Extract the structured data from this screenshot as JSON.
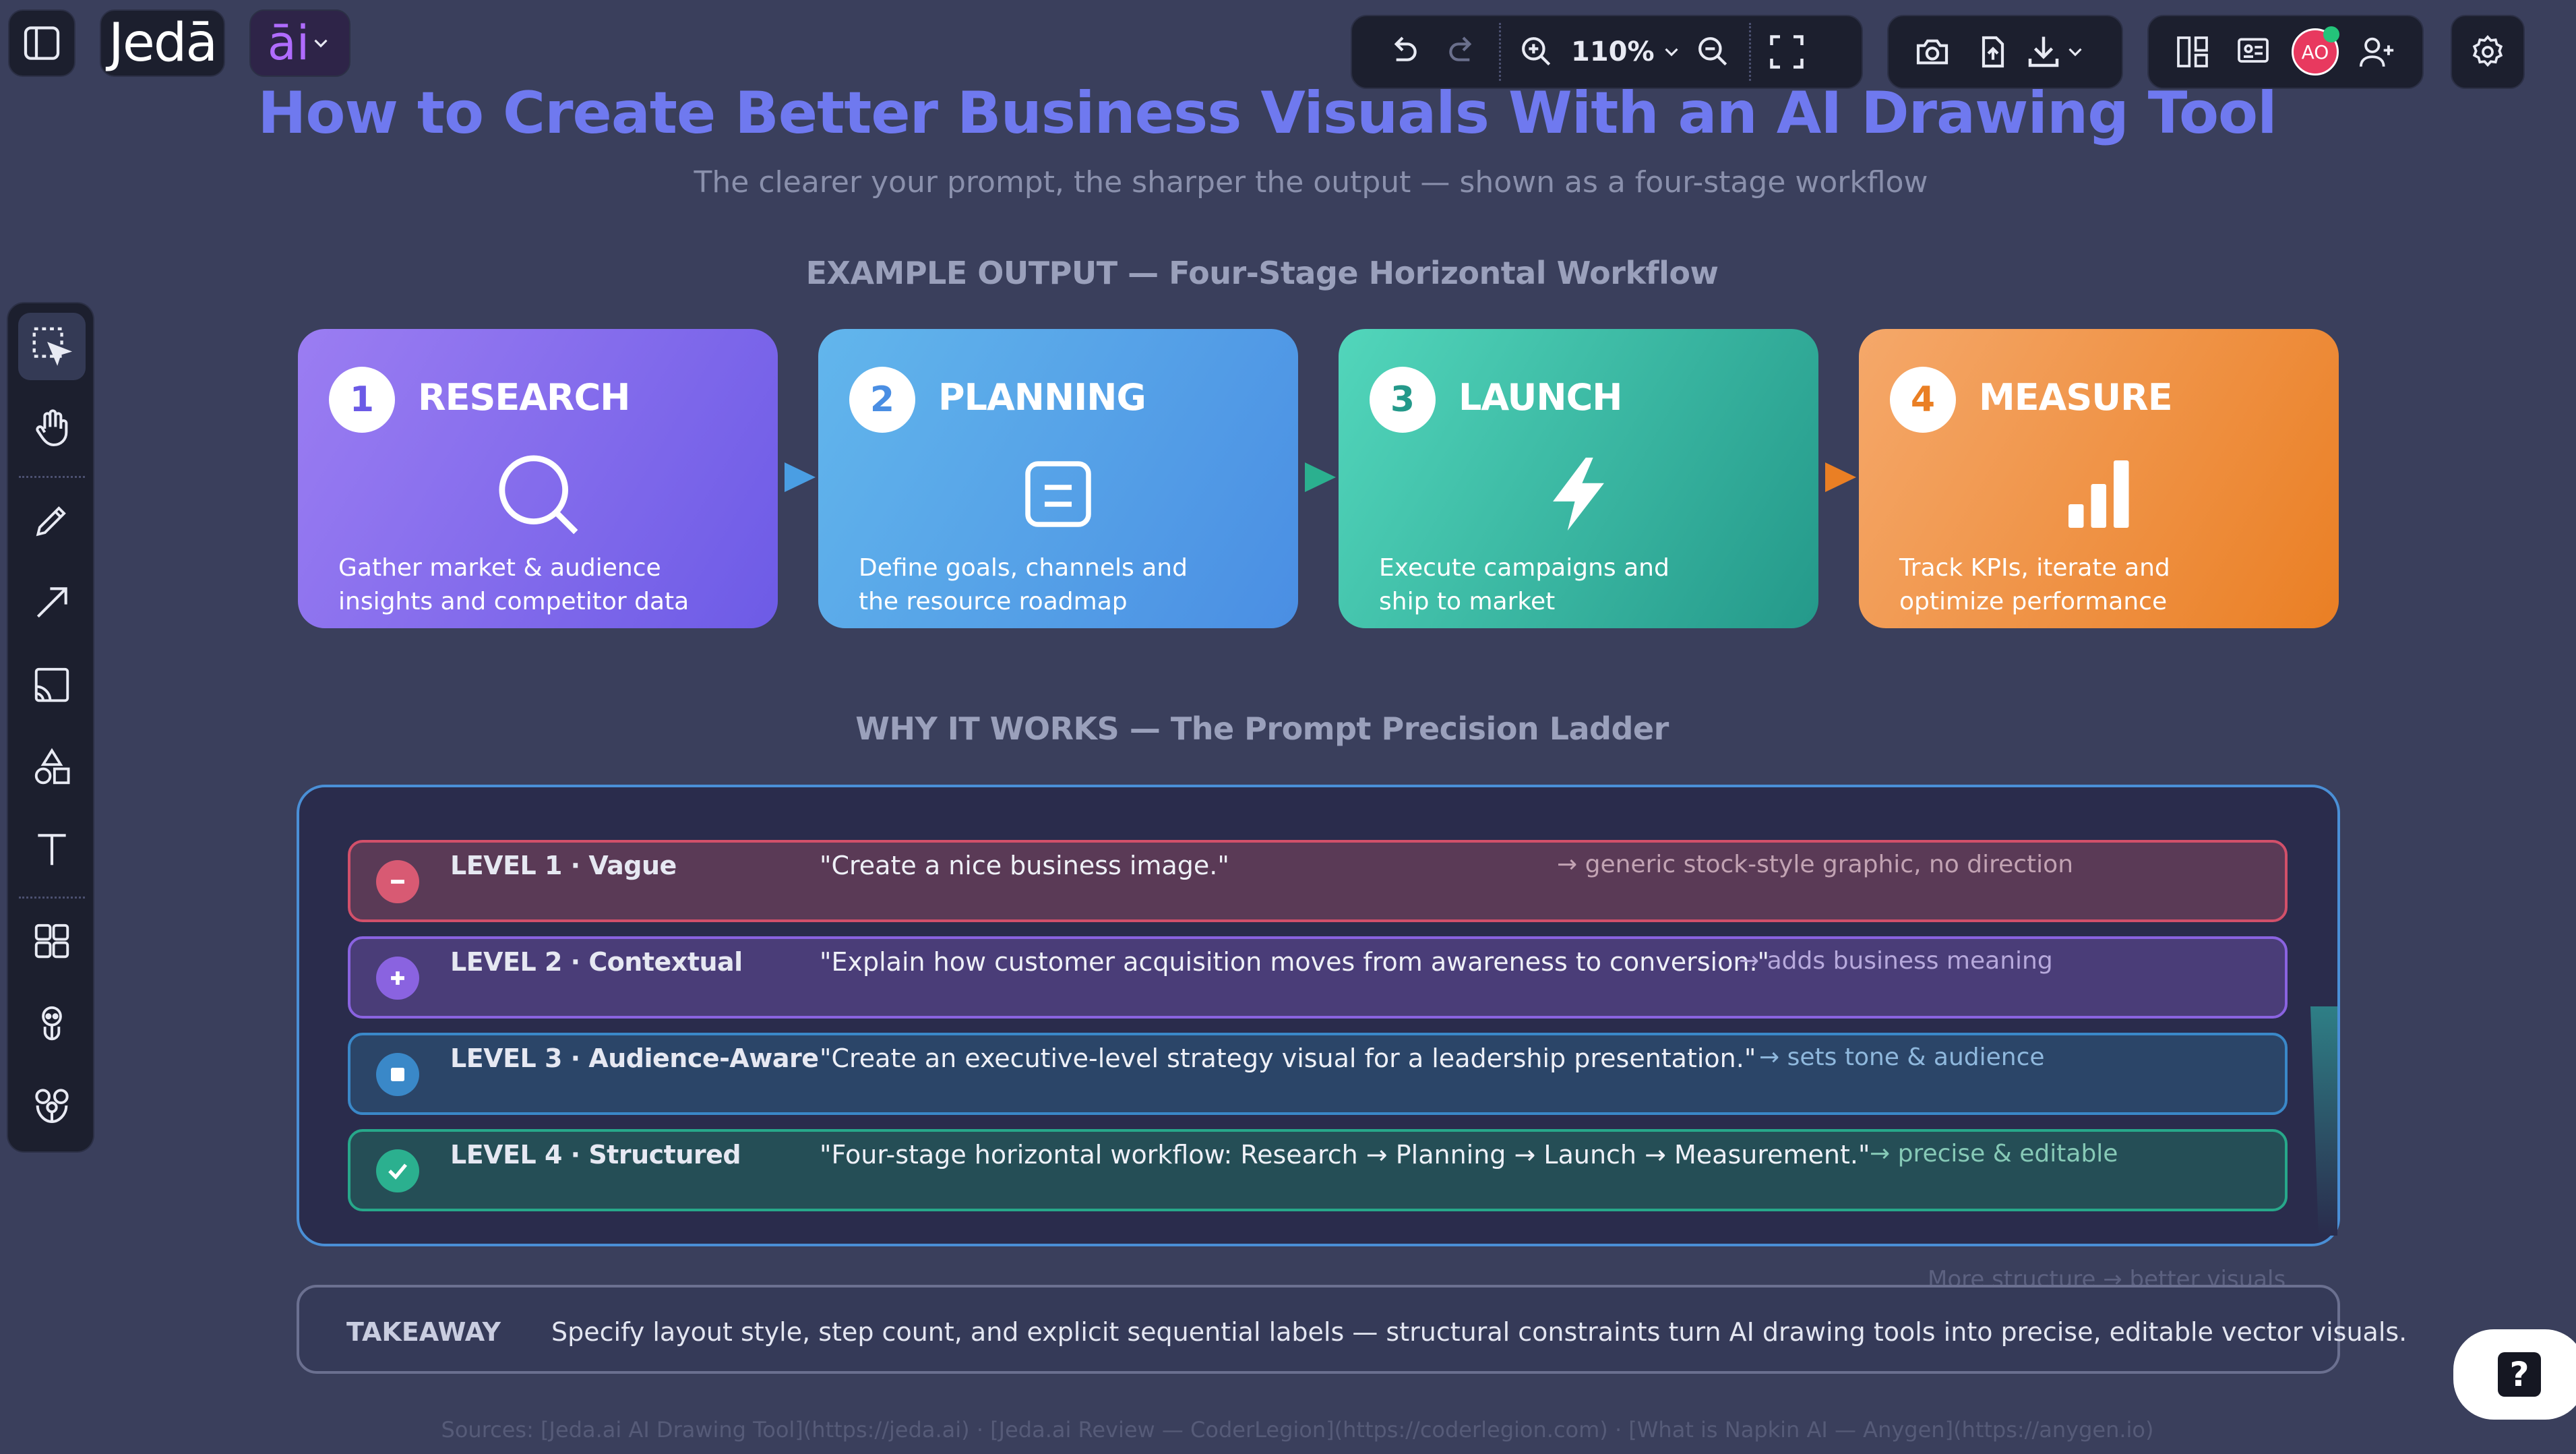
{
  "app": {
    "logo_text": "Jedā",
    "ai_menu_label": "āi"
  },
  "toolbar": {
    "zoom_level": "110%"
  },
  "user": {
    "initials": "AO"
  },
  "canvas": {
    "title": "How to Create Better Business Visuals With an AI Drawing Tool",
    "subtitle": "The clearer your prompt, the sharper the output — shown as a four-stage workflow",
    "workflow_heading": "EXAMPLE OUTPUT — Four-Stage Horizontal Workflow",
    "stages": [
      {
        "number": "1",
        "title": "RESEARCH",
        "icon": "search-icon",
        "line1": "Gather market & audience",
        "line2": "insights and competitor data",
        "color_from": "#9b7df2",
        "color_to": "#6d5be6",
        "num_color": "#6b5ae6"
      },
      {
        "number": "2",
        "title": "PLANNING",
        "icon": "document-icon",
        "line1": "Define goals, channels and",
        "line2": "the resource roadmap",
        "color_from": "#62b6ec",
        "color_to": "#4a8ee3",
        "num_color": "#4a8ee3"
      },
      {
        "number": "3",
        "title": "LAUNCH",
        "icon": "lightning-icon",
        "line1": "Execute campaigns and",
        "line2": "ship to market",
        "color_from": "#52d6bb",
        "color_to": "#24998a",
        "num_color": "#24998a"
      },
      {
        "number": "4",
        "title": "MEASURE",
        "icon": "bar-chart-icon",
        "line1": "Track KPIs, iterate and",
        "line2": "optimize performance",
        "color_from": "#f5a86a",
        "color_to": "#ea7f24",
        "num_color": "#ea7f24"
      }
    ],
    "ladder_heading": "WHY IT WORKS — The Prompt Precision Ladder",
    "levels": [
      {
        "name": "LEVEL 1 · Vague",
        "quote": "\"Create a nice business image.\"",
        "result": "→ generic stock-style graphic, no direction",
        "icon": "minus-icon",
        "accent": "#d2506a",
        "fill": "#5a3a56",
        "badge": "#d85a73"
      },
      {
        "name": "LEVEL 2 · Contextual",
        "quote": "\"Explain how customer acquisition moves from awareness to conversion.\"",
        "result": "→ adds business meaning",
        "icon": "plus-icon",
        "accent": "#8a63e0",
        "fill": "#4a3d78",
        "badge": "#8a63e0"
      },
      {
        "name": "LEVEL 3 · Audience-Aware",
        "quote": "\"Create an executive-level strategy visual for a leadership presentation.\"",
        "result": "→ sets tone & audience",
        "icon": "square-icon",
        "accent": "#3a88c8",
        "fill": "#2b4568",
        "badge": "#3a88c8"
      },
      {
        "name": "LEVEL 4 · Structured",
        "quote": "\"Four-stage horizontal workflow: Research → Planning → Launch → Measurement.\"",
        "result": "→ precise & editable",
        "icon": "check-icon",
        "accent": "#27a88a",
        "fill": "#254e56",
        "badge": "#2bb08f"
      }
    ],
    "faded_caption": "More structure → better visuals",
    "takeaway_label": "TAKEAWAY",
    "takeaway_text": "Specify layout style, step count, and explicit sequential labels — structural constraints turn AI drawing tools into precise, editable vector visuals.",
    "sources": "Sources: [Jeda.ai AI Drawing Tool](https://jeda.ai) · [Jeda.ai Review — CoderLegion](https://coderlegion.com) · [What is Napkin AI — Anygen](https://anygen.io)"
  },
  "help": {
    "label": "?"
  }
}
